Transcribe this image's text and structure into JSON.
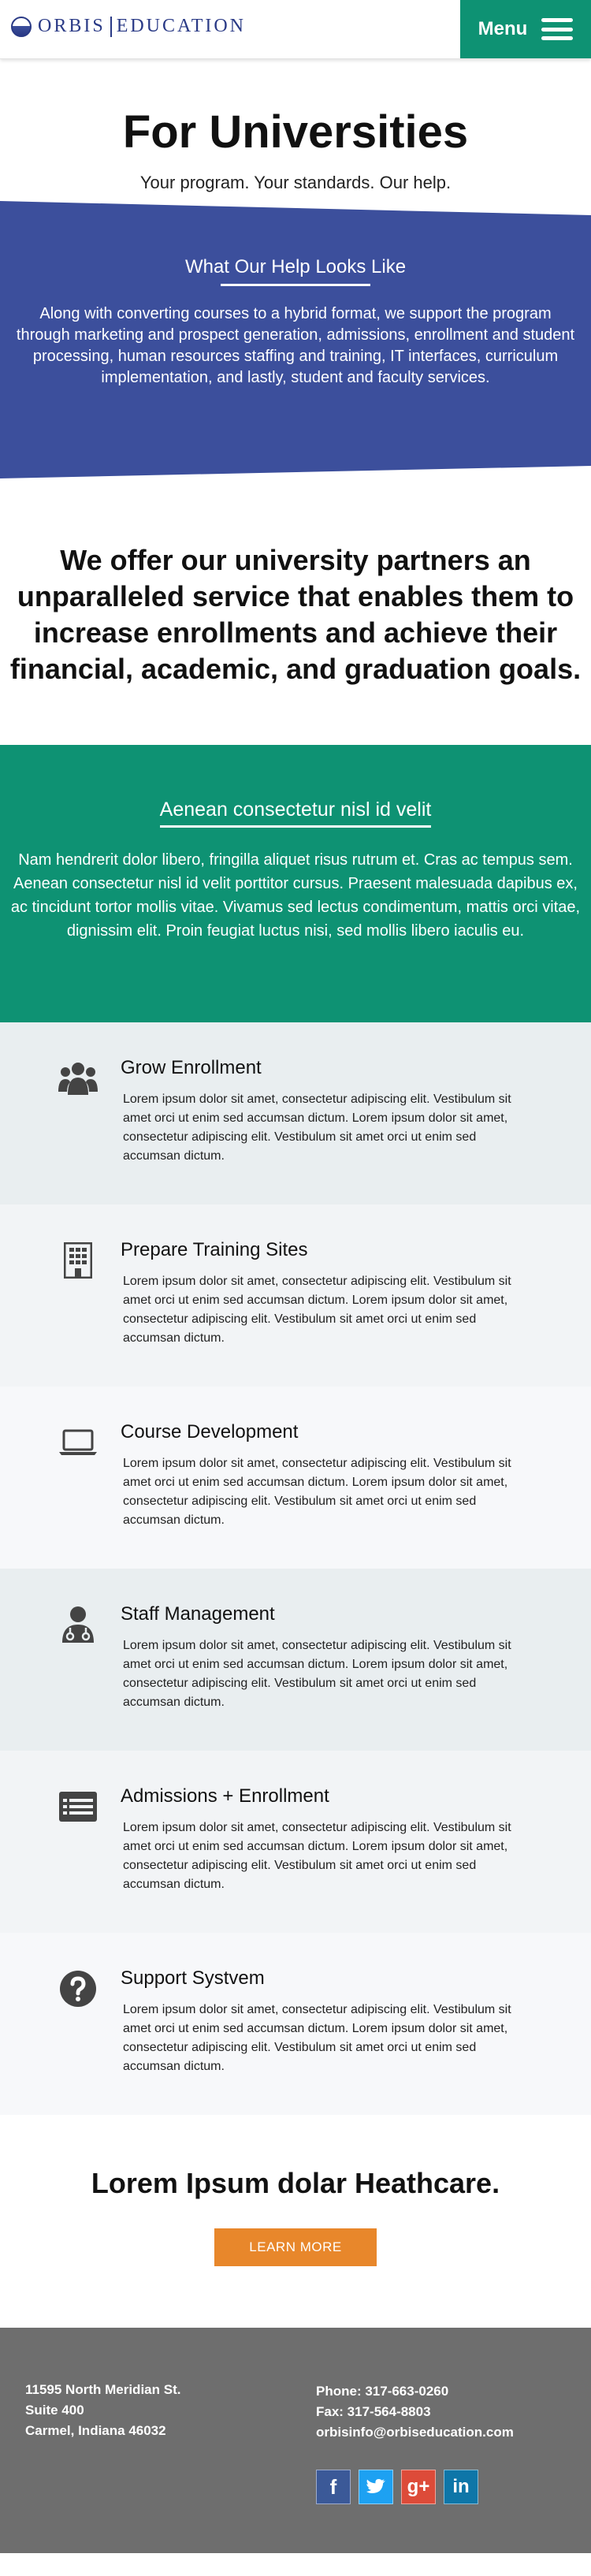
{
  "header": {
    "logo_left": "ORBIS",
    "logo_right": "EDUCATION",
    "menu_label": "Menu"
  },
  "hero": {
    "title": "For Universities",
    "subtitle": "Your program. Your standards. Our help."
  },
  "help": {
    "title": "What Our Help Looks Like",
    "text": "Along with converting courses to a hybrid format, we support the program through marketing and prospect generation, admissions, enrollment and student processing, human resources staffing and training, IT interfaces, curriculum implementation, and lastly, student and faculty services."
  },
  "offer": {
    "text": "We offer our university partners an unparalleled service that enables them to increase enrollments and achieve their financial, academic, and graduation goals."
  },
  "green": {
    "title": "Aenean consectetur nisl id velit",
    "text": "Nam hendrerit dolor libero, fringilla aliquet risus rutrum et. Cras ac tempus sem. Aenean consectetur nisl id velit porttitor cursus. Praesent malesuada dapibus ex, ac tincidunt tortor mollis vitae. Vivamus sed lectus condimentum, mattis orci vitae, dignissim elit. Proin feugiat luctus nisi, sed mollis libero iaculis eu."
  },
  "services": [
    {
      "title": "Grow Enrollment",
      "icon": "group-icon",
      "text": "Lorem ipsum dolor sit amet, consectetur adipiscing elit. Vestibulum sit amet orci ut enim sed accumsan dictum.  Lorem ipsum dolor sit amet, consectetur adipiscing elit. Vestibulum sit amet orci ut enim sed accumsan dictum."
    },
    {
      "title": "Prepare Training Sites",
      "icon": "building-icon",
      "text": "Lorem ipsum dolor sit amet, consectetur adipiscing elit. Vestibulum sit amet orci ut enim sed accumsan dictum.  Lorem ipsum dolor sit amet, consectetur adipiscing elit. Vestibulum sit amet orci ut enim sed accumsan dictum."
    },
    {
      "title": "Course Development",
      "icon": "laptop-icon",
      "text": "Lorem ipsum dolor sit amet, consectetur adipiscing elit. Vestibulum sit amet orci ut enim sed accumsan dictum.  Lorem ipsum dolor sit amet, consectetur adipiscing elit. Vestibulum sit amet orci ut enim sed accumsan dictum."
    },
    {
      "title": "Staff Management",
      "icon": "doctor-icon",
      "text": "Lorem ipsum dolor sit amet, consectetur adipiscing elit. Vestibulum sit amet orci ut enim sed accumsan dictum.  Lorem ipsum dolor sit amet, consectetur adipiscing elit. Vestibulum sit amet orci ut enim sed accumsan dictum."
    },
    {
      "title": "Admissions + Enrollment",
      "icon": "list-card-icon",
      "text": "Lorem ipsum dolor sit amet, consectetur adipiscing elit. Vestibulum sit amet orci ut enim sed accumsan dictum.  Lorem ipsum dolor sit amet, consectetur adipiscing elit. Vestibulum sit amet orci ut enim sed accumsan dictum."
    },
    {
      "title": "Support Systvem",
      "icon": "question-circle-icon",
      "text": "Lorem ipsum dolor sit amet, consectetur adipiscing elit. Vestibulum sit amet orci ut enim sed accumsan dictum.  Lorem ipsum dolor sit amet, consectetur adipiscing elit. Vestibulum sit amet orci ut enim sed accumsan dictum."
    }
  ],
  "cta": {
    "title": "Lorem Ipsum dolar Heathcare.",
    "button": "LEARN MORE"
  },
  "footer": {
    "address_line1": "11595 North Meridian St.",
    "address_line2": "Suite 400",
    "address_line3": "Carmel, Indiana 46032",
    "phone": "Phone: 317-663-0260",
    "fax": "Fax: 317-564-8803",
    "email": "orbisinfo@orbiseducation.com",
    "social": [
      {
        "label": "f",
        "icon": "facebook-icon",
        "color": "#3b5998"
      },
      {
        "label": "t",
        "icon": "twitter-icon",
        "color": "#1da1f2"
      },
      {
        "label": "g+",
        "icon": "google-plus-icon",
        "color": "#dd4b39"
      },
      {
        "label": "in",
        "icon": "linkedin-icon",
        "color": "#0e76a8"
      }
    ]
  },
  "colors": {
    "blue": "#3c4f9c",
    "green": "#0e9273",
    "orange": "#e8872b",
    "footer": "#6e6e6e"
  }
}
